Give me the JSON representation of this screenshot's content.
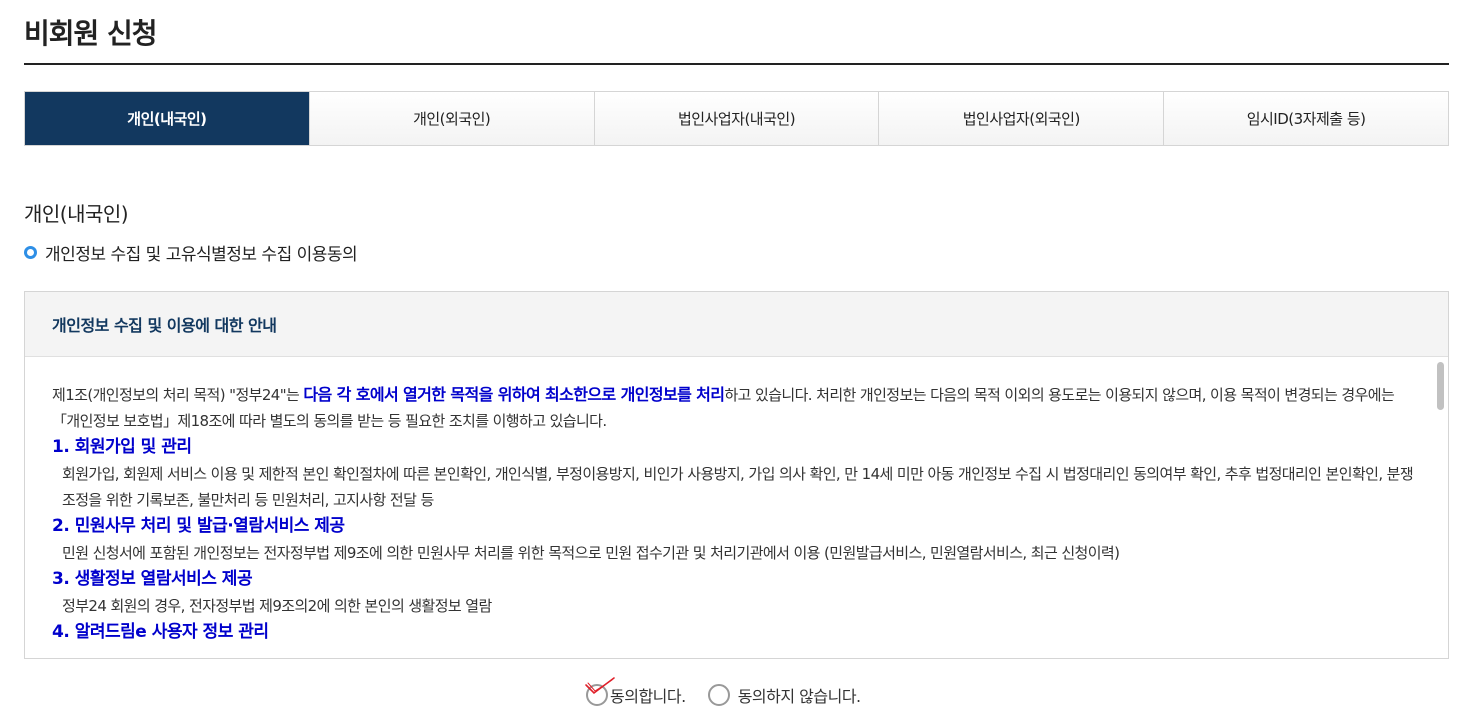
{
  "page": {
    "title": "비회원 신청"
  },
  "tabs": [
    {
      "label": "개인(내국인)",
      "active": true
    },
    {
      "label": "개인(외국인)",
      "active": false
    },
    {
      "label": "법인사업자(내국인)",
      "active": false
    },
    {
      "label": "법인사업자(외국인)",
      "active": false
    },
    {
      "label": "임시ID(3자제출 등)",
      "active": false
    }
  ],
  "section": {
    "title": "개인(내국인)",
    "subtitle": "개인정보 수집 및 고유식별정보 수집 이용동의"
  },
  "notice": {
    "header": "개인정보 수집 및 이용에 대한 안내",
    "intro_before": "제1조(개인정보의 처리 목적) \"정부24\"는 ",
    "intro_highlight": "다음 각 호에서 열거한 목적을 위하여 최소한으로 개인정보를 처리",
    "intro_after": "하고 있습니다. 처리한 개인정보는 다음의 목적 이외의 용도로는 이용되지 않으며, 이용 목적이 변경되는 경우에는「개인정보 보호법」제18조에 따라 별도의 동의를 받는 등 필요한 조치를 이행하고 있습니다.",
    "items": [
      {
        "head": "1. 회원가입 및 관리",
        "text": "회원가입, 회원제 서비스 이용 및 제한적 본인 확인절차에 따른 본인확인, 개인식별, 부정이용방지, 비인가 사용방지, 가입 의사 확인, 만 14세 미만 아동 개인정보 수집 시 법정대리인 동의여부 확인, 추후 법정대리인 본인확인, 분쟁 조정을 위한 기록보존, 불만처리 등 민원처리, 고지사항 전달 등"
      },
      {
        "head": "2. 민원사무 처리 및 발급·열람서비스 제공",
        "text": "민원 신청서에 포함된 개인정보는 전자정부법 제9조에 의한 민원사무 처리를 위한 목적으로 민원 접수기관 및 처리기관에서 이용 (민원발급서비스, 민원열람서비스, 최근 신청이력)"
      },
      {
        "head": "3. 생활정보 열람서비스 제공",
        "text": "정부24 회원의 경우, 전자정부법 제9조의2에 의한 본인의 생활정보 열람"
      },
      {
        "head": "4. 알려드림e 사용자 정보 관리",
        "text": ""
      }
    ]
  },
  "consent": {
    "agree_label": "동의합니다.",
    "disagree_label": "동의하지 않습니다.",
    "check_color": "#e0202a"
  }
}
